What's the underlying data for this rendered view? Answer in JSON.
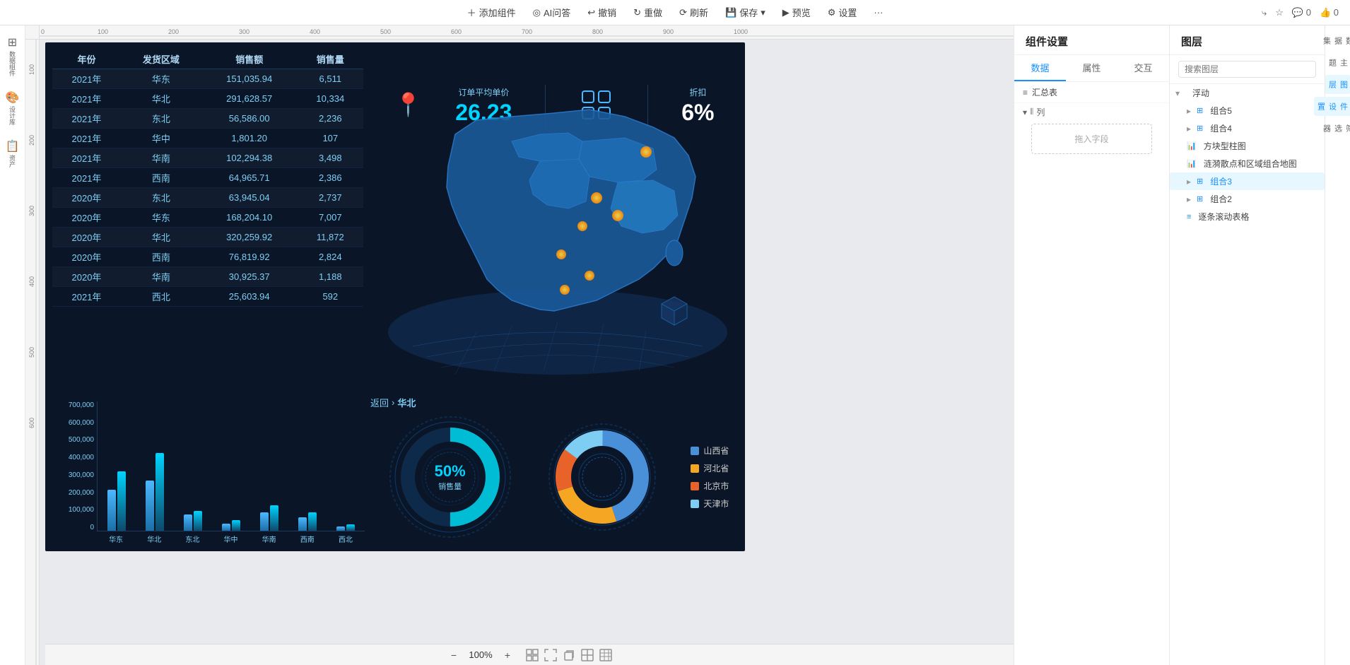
{
  "toolbar": {
    "add_component": "添加组件",
    "ai_qa": "AI问答",
    "undo": "撤销",
    "redo": "重做",
    "refresh": "刷新",
    "save": "保存",
    "preview": "预览",
    "settings": "设置",
    "more": "···",
    "share_icon": "share",
    "star_icon": "star",
    "comment_count": "0",
    "like_count": "0"
  },
  "left_sidebar": {
    "items": [
      {
        "label": "数\n据\n组\n件",
        "icon": "⊞"
      },
      {
        "label": "设\n计\n库",
        "icon": "🎨"
      },
      {
        "label": "资\n产",
        "icon": "📋"
      }
    ]
  },
  "dashboard": {
    "table": {
      "headers": [
        "年份",
        "发货区域",
        "销售额",
        "销售量"
      ],
      "rows": [
        [
          "2021年",
          "华东",
          "151,035.94",
          "6,511"
        ],
        [
          "2021年",
          "华北",
          "291,628.57",
          "10,334"
        ],
        [
          "2021年",
          "东北",
          "56,586.00",
          "2,236"
        ],
        [
          "2021年",
          "华中",
          "1,801.20",
          "107"
        ],
        [
          "2021年",
          "华南",
          "102,294.38",
          "3,498"
        ],
        [
          "2021年",
          "西南",
          "64,965.71",
          "2,386"
        ],
        [
          "2020年",
          "东北",
          "63,945.04",
          "2,737"
        ],
        [
          "2020年",
          "华东",
          "168,204.10",
          "7,007"
        ],
        [
          "2020年",
          "华北",
          "320,259.92",
          "11,872"
        ],
        [
          "2020年",
          "西南",
          "76,819.92",
          "2,824"
        ],
        [
          "2020年",
          "华南",
          "30,925.37",
          "1,188"
        ],
        [
          "2021年",
          "西北",
          "25,603.94",
          "592"
        ]
      ]
    },
    "kpi": {
      "order_avg_label": "订单平均单价",
      "order_avg_value": "26.23",
      "discount_label": "折扣",
      "discount_value": "6%"
    },
    "nav": {
      "back": "返回",
      "separator": "›",
      "current": "华北"
    },
    "donut1": {
      "value": "50%",
      "label": "销售量"
    },
    "donut2": {
      "legend": [
        {
          "color": "#4a90d9",
          "label": "山西省"
        },
        {
          "color": "#f5a623",
          "label": "河北省"
        },
        {
          "color": "#e8632a",
          "label": "北京市"
        },
        {
          "color": "#7ecef4",
          "label": "天津市"
        }
      ]
    },
    "bar_chart": {
      "y_labels": [
        "700,000",
        "600,000",
        "500,000",
        "400,000",
        "300,000",
        "200,000",
        "100,000",
        "0"
      ],
      "x_labels": [
        "华东",
        "华北",
        "东北",
        "华中",
        "华南",
        "西南",
        "西北"
      ],
      "bars": [
        {
          "label": "华东",
          "h1": 0.45,
          "h2": 0.65
        },
        {
          "label": "华北",
          "h1": 0.55,
          "h2": 0.85
        },
        {
          "label": "东北",
          "h1": 0.18,
          "h2": 0.22
        },
        {
          "label": "华中",
          "h1": 0.08,
          "h2": 0.12
        },
        {
          "label": "华南",
          "h1": 0.2,
          "h2": 0.28
        },
        {
          "label": "西南",
          "h1": 0.15,
          "h2": 0.2
        },
        {
          "label": "西北",
          "h1": 0.05,
          "h2": 0.07
        }
      ]
    }
  },
  "comp_settings": {
    "title": "组件设置",
    "tabs": [
      "数据",
      "属性",
      "交互"
    ],
    "active_tab": "数据",
    "search_placeholder": "搜索图层",
    "data_source": {
      "icon": "≡",
      "label": "汇总表"
    },
    "col_section": {
      "icon": "|||",
      "label": "列"
    },
    "drag_placeholder": "拖入字段"
  },
  "layers": {
    "title": "图层",
    "search_placeholder": "搜索图层",
    "tree": [
      {
        "label": "浮动",
        "type": "folder",
        "expanded": true,
        "indent": 0
      },
      {
        "label": "组合5",
        "type": "group",
        "indent": 1
      },
      {
        "label": "组合4",
        "type": "group",
        "indent": 1
      },
      {
        "label": "方块型柱图",
        "type": "chart",
        "indent": 1
      },
      {
        "label": "涟漪散点和区域组合地图",
        "type": "chart",
        "indent": 1
      },
      {
        "label": "组合3",
        "type": "group",
        "indent": 1,
        "selected": true
      },
      {
        "label": "组合2",
        "type": "group",
        "indent": 1
      },
      {
        "label": "逐条滚动表格",
        "type": "table",
        "indent": 1
      }
    ]
  },
  "bottom_bar": {
    "zoom_minus": "−",
    "zoom_level": "100%",
    "zoom_plus": "+"
  },
  "far_right": {
    "items": [
      "数据集",
      "主题",
      "图层",
      "组件设置",
      "筛选器"
    ]
  },
  "colors": {
    "accent_blue": "#1890ff",
    "dark_bg": "#0a1628",
    "table_text": "#7ecef4",
    "border": "#1e3a5f"
  }
}
